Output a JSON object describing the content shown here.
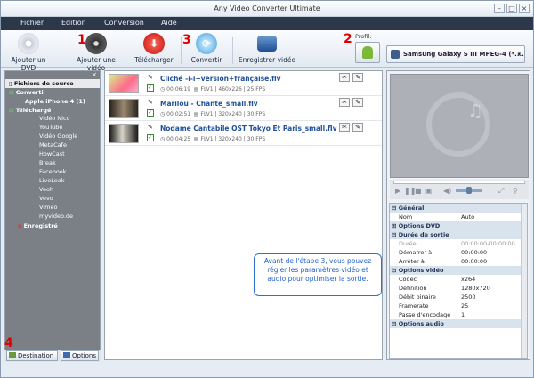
{
  "window": {
    "title": "Any Video Converter Ultimate"
  },
  "menu": [
    "Fichier",
    "Edition",
    "Conversion",
    "Aide"
  ],
  "toolbar": {
    "add_dvd": "Ajouter un DVD",
    "add_video": "Ajouter une vidéo",
    "download": "Télécharger",
    "convert": "Convertir",
    "record": "Enregistrer vidéo",
    "profile_label": "Profil:",
    "profile_value": "Samsung Galaxy S III MPEG-4 (*...."
  },
  "steps": {
    "s1": "1",
    "s2": "2",
    "s3": "3",
    "s4": "4"
  },
  "sidebar": {
    "root": "Fichiers de source",
    "converted": "Converti",
    "converted_child": "Apple iPhone 4 (1)",
    "downloaded": "Téléchargé",
    "sites": [
      "Vidéo Nico",
      "YouTube",
      "Vidéo Google",
      "MetaCafe",
      "HowCast",
      "Break",
      "Facebook",
      "LiveLeak",
      "Veoh",
      "Vevo",
      "Vimeo",
      "myvideo.de"
    ],
    "recorded": "Enregistré",
    "destination": "Destination",
    "options": "Options"
  },
  "files": [
    {
      "name": "Cliché -i-i+version+française.flv",
      "duration": "00:06:19",
      "codec": "FLV1",
      "res": "460x226",
      "fps": "25 FPS"
    },
    {
      "name": "Marilou - Chante_small.flv",
      "duration": "00:02:51",
      "codec": "FLV1",
      "res": "320x240",
      "fps": "30 FPS"
    },
    {
      "name": "Nodame Cantabile OST Tokyo Et Paris_small.flv",
      "duration": "00:04:25",
      "codec": "FLV1",
      "res": "320x240",
      "fps": "30 FPS"
    }
  ],
  "props": {
    "general": "Général",
    "name_k": "Nom",
    "name_v": "Auto",
    "dvd": "Options DVD",
    "duration": "Durée de sortie",
    "dur_k": "Durée",
    "dur_v": "00:00:00-00:00:00",
    "start_k": "Démarrer à",
    "start_v": "00:00:00",
    "stop_k": "Arrêter à",
    "stop_v": "00:00:00",
    "video": "Options vidéo",
    "codec_k": "Codec",
    "codec_v": "x264",
    "res_k": "Définition",
    "res_v": "1280x720",
    "bitrate_k": "Débit binaire",
    "bitrate_v": "2500",
    "fps_k": "Framerate",
    "fps_v": "25",
    "pass_k": "Passe d'encodage",
    "pass_v": "1",
    "audio": "Options audio"
  },
  "callout": "Avant de l'étape 3, vous pouvez régler les paramètres vidéo et audio pour optimiser la sortie.",
  "colors": {
    "menubar": "#2c3849",
    "step": "#e00000",
    "callout": "#2060d0",
    "sidebar": "#7b7f86"
  }
}
